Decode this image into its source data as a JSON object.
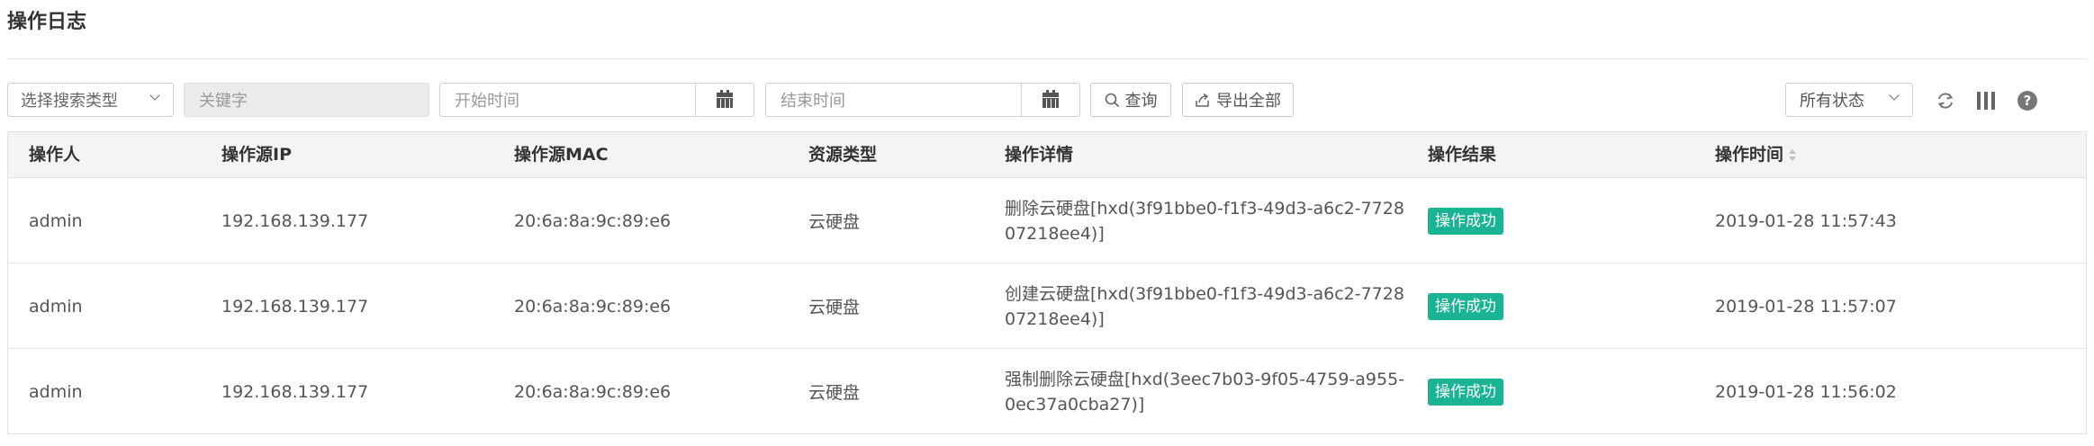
{
  "page": {
    "title": "操作日志"
  },
  "toolbar": {
    "search_type": "选择搜索类型",
    "keyword_placeholder": "关键字",
    "start_placeholder": "开始时间",
    "end_placeholder": "结束时间",
    "search_label": "查询",
    "export_label": "导出全部",
    "status_label": "所有状态"
  },
  "table": {
    "columns": [
      "操作人",
      "操作源IP",
      "操作源MAC",
      "资源类型",
      "操作详情",
      "操作结果",
      "操作时间"
    ],
    "rows": [
      {
        "user": "admin",
        "ip": "192.168.139.177",
        "mac": "20:6a:8a:9c:89:e6",
        "resource": "云硬盘",
        "detail": "删除云硬盘[hxd(3f91bbe0-f1f3-49d3-a6c2-772807218ee4)]",
        "result": "操作成功",
        "time": "2019-01-28 11:57:43"
      },
      {
        "user": "admin",
        "ip": "192.168.139.177",
        "mac": "20:6a:8a:9c:89:e6",
        "resource": "云硬盘",
        "detail": "创建云硬盘[hxd(3f91bbe0-f1f3-49d3-a6c2-772807218ee4)]",
        "result": "操作成功",
        "time": "2019-01-28 11:57:07"
      },
      {
        "user": "admin",
        "ip": "192.168.139.177",
        "mac": "20:6a:8a:9c:89:e6",
        "resource": "云硬盘",
        "detail": "强制删除云硬盘[hxd(3eec7b03-9f05-4759-a955-0ec37a0cba27)]",
        "result": "操作成功",
        "time": "2019-01-28 11:56:02"
      }
    ]
  },
  "colors": {
    "success": "#1ab394",
    "header_bg": "#f4f4f4",
    "border": "#e1e1e1"
  }
}
